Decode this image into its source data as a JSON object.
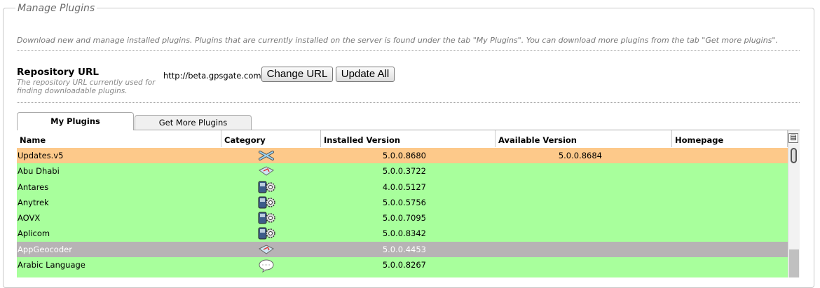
{
  "panel": {
    "legend": "Manage Plugins",
    "description": "Download new and manage installed plugins. Plugins that are currently installed on the server is found under the tab \"My Plugins\". You can download more plugins from the tab \"Get more plugins\"."
  },
  "repository": {
    "title": "Repository URL",
    "subtitle": "The repository URL currently used for finding downloadable plugins.",
    "url": "http://beta.gpsgate.com",
    "change_label": "Change URL",
    "update_all_label": "Update All"
  },
  "tabs": [
    {
      "label": "My Plugins",
      "active": true
    },
    {
      "label": "Get More Plugins",
      "active": false
    }
  ],
  "table": {
    "columns": [
      "Name",
      "Category",
      "Installed Version",
      "Available Version",
      "Homepage"
    ],
    "rows": [
      {
        "name": "Updates.v5",
        "category_icon": "update-icon",
        "installed": "5.0.0.8680",
        "available": "5.0.0.8684",
        "homepage": "",
        "status": "update-available",
        "color": "#fdc98a"
      },
      {
        "name": "Abu Dhabi",
        "category_icon": "map-icon",
        "installed": "5.0.0.3722",
        "available": "",
        "homepage": "",
        "status": "installed",
        "color": "#a8ff9c"
      },
      {
        "name": "Antares",
        "category_icon": "device-gear-icon",
        "installed": "4.0.0.5127",
        "available": "",
        "homepage": "",
        "status": "installed",
        "color": "#a8ff9c"
      },
      {
        "name": "Anytrek",
        "category_icon": "device-gear-icon",
        "installed": "5.0.0.5756",
        "available": "",
        "homepage": "",
        "status": "installed",
        "color": "#a8ff9c"
      },
      {
        "name": "AOVX",
        "category_icon": "device-gear-icon",
        "installed": "5.0.0.7095",
        "available": "",
        "homepage": "",
        "status": "installed",
        "color": "#a8ff9c"
      },
      {
        "name": "Aplicom",
        "category_icon": "device-gear-icon",
        "installed": "5.0.0.8342",
        "available": "",
        "homepage": "",
        "status": "installed",
        "color": "#a8ff9c"
      },
      {
        "name": "AppGeocoder",
        "category_icon": "map-icon",
        "installed": "5.0.0.4453",
        "available": "",
        "homepage": "",
        "status": "disabled",
        "color": "#b7b3b5"
      },
      {
        "name": "Arabic Language",
        "category_icon": "language-bubble-icon",
        "installed": "5.0.0.8267",
        "available": "",
        "homepage": "",
        "status": "installed",
        "color": "#a8ff9c"
      },
      {
        "name": "",
        "category_icon": "",
        "installed": "",
        "available": "",
        "homepage": "",
        "status": "installed",
        "color": "#a8ff9c"
      }
    ]
  }
}
